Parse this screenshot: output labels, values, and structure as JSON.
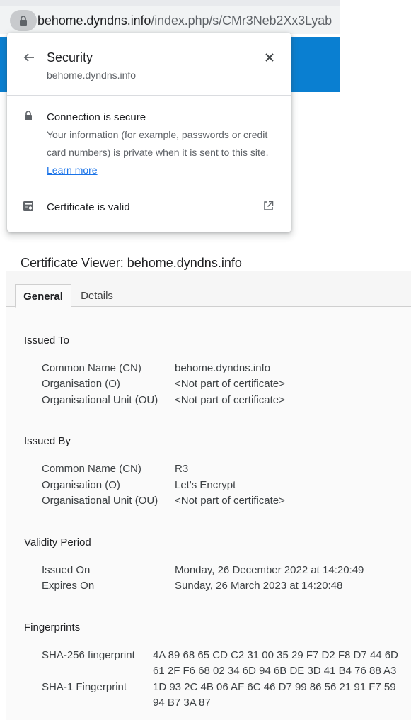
{
  "browser": {
    "url_host": "behome.dyndns.info",
    "url_path": "/index.php/s/CMr3Neb2Xx3Lyab"
  },
  "security_popup": {
    "title": "Security",
    "subtitle": "behome.dyndns.info",
    "connection_title": "Connection is secure",
    "connection_desc": "Your information (for example, passwords or credit card numbers) is private when it is sent to this site.",
    "learn_more": "Learn more",
    "certificate_label": "Certificate is valid"
  },
  "viewer": {
    "title": "Certificate Viewer: behome.dyndns.info",
    "tabs": [
      "General",
      "Details"
    ],
    "issued_to": {
      "title": "Issued To",
      "rows": [
        {
          "label": "Common Name (CN)",
          "value": "behome.dyndns.info"
        },
        {
          "label": "Organisation (O)",
          "value": "<Not part of certificate>"
        },
        {
          "label": "Organisational Unit (OU)",
          "value": "<Not part of certificate>"
        }
      ]
    },
    "issued_by": {
      "title": "Issued By",
      "rows": [
        {
          "label": "Common Name (CN)",
          "value": "R3"
        },
        {
          "label": "Organisation (O)",
          "value": "Let's Encrypt"
        },
        {
          "label": "Organisational Unit (OU)",
          "value": "<Not part of certificate>"
        }
      ]
    },
    "validity": {
      "title": "Validity Period",
      "rows": [
        {
          "label": "Issued On",
          "value": "Monday, 26 December 2022 at 14:20:49"
        },
        {
          "label": "Expires On",
          "value": "Sunday, 26 March 2023 at 14:20:48"
        }
      ]
    },
    "fingerprints": {
      "title": "Fingerprints",
      "rows": [
        {
          "label": "SHA-256 fingerprint",
          "value": "4A 89 68 65 CD C2 31 00 35 29 F7 D2 F8 D7 44 6D 61 2F F6 68 02 34 6D 94 6B DE 3D 41 B4 76 88 A3"
        },
        {
          "label": "SHA-1 Fingerprint",
          "value": "1D 93 2C 4B 06 AF 6C 46 D7 99 86 56 21 91 F7 59 94 B7 3A 87"
        }
      ]
    }
  },
  "icons": {
    "lock": "lock-icon",
    "back": "arrow-back-icon",
    "close": "close-icon",
    "certificate": "certificate-icon",
    "external": "open-external-icon"
  },
  "colors": {
    "accent_bar": "#0a7fd1",
    "link": "#1a73e8"
  }
}
